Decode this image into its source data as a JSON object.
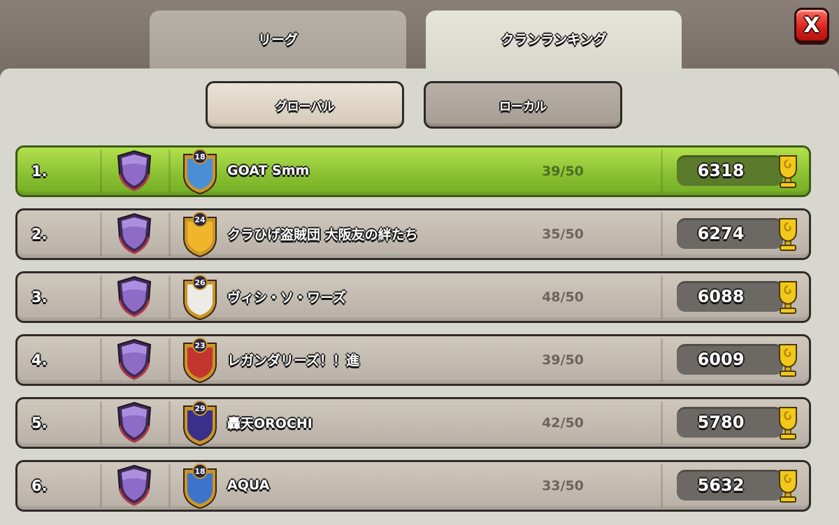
{
  "tabs": {
    "league": "リーグ",
    "clan_ranking": "クランランキング"
  },
  "close_label": "X",
  "subtabs": {
    "global": "グローバル",
    "local": "ローカル"
  },
  "colors": {
    "highlight_row": "#8bc233",
    "row": "#c3bcb1",
    "close": "#d8211b"
  },
  "rows": [
    {
      "rank": "1.",
      "name": "GOAT Smm",
      "level": "18",
      "members": "39/50",
      "trophies": "6318",
      "badge_color": "#4a8fd6",
      "badge_icon": "fire-shield-badge-icon"
    },
    {
      "rank": "2.",
      "name": "クラひげ盗賊団 大阪友の絆たち",
      "level": "24",
      "members": "35/50",
      "trophies": "6274",
      "badge_color": "#f0b52a",
      "badge_icon": "lightning-badge-icon"
    },
    {
      "rank": "3.",
      "name": "ヴィシ・ソ・ワーズ",
      "level": "26",
      "members": "48/50",
      "trophies": "6088",
      "badge_color": "#ecebe6",
      "badge_icon": "blank-shield-badge-icon"
    },
    {
      "rank": "4.",
      "name": "レガンダリーズ！！進",
      "level": "23",
      "members": "39/50",
      "trophies": "6009",
      "badge_color": "#c2362e",
      "badge_icon": "flame-badge-icon"
    },
    {
      "rank": "5.",
      "name": "轟天OROCHI",
      "level": "29",
      "members": "42/50",
      "trophies": "5780",
      "badge_color": "#3a2f8a",
      "badge_icon": "flame-badge-icon"
    },
    {
      "rank": "6.",
      "name": "AQUA",
      "level": "18",
      "members": "33/50",
      "trophies": "5632",
      "badge_color": "#3d74c9",
      "badge_icon": "striped-shield-badge-icon"
    }
  ]
}
